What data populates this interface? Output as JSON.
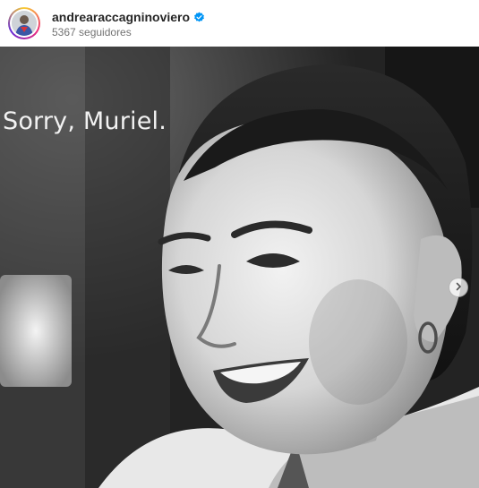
{
  "header": {
    "username": "andrearaccagninoviero",
    "verified_icon": "verified-badge-icon",
    "followers_text": "5367 seguidores",
    "avatar_icon": "profile-avatar"
  },
  "post": {
    "overlay_text": "Sorry, Muriel.",
    "next_icon": "chevron-right-icon"
  },
  "colors": {
    "verified_blue": "#0095f6",
    "username_text": "#262626",
    "secondary_text": "#737373"
  }
}
